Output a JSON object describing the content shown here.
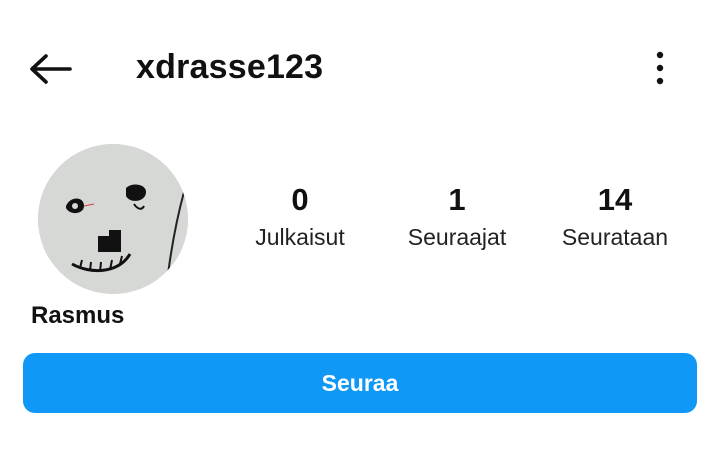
{
  "header": {
    "username": "xdrasse123",
    "back_icon": "arrow-left-icon",
    "more_icon": "more-vertical-icon"
  },
  "profile": {
    "display_name": "Rasmus",
    "avatar_description_icon": "avatar"
  },
  "stats": [
    {
      "value": "0",
      "label": "Julkaisut"
    },
    {
      "value": "1",
      "label": "Seuraajat"
    },
    {
      "value": "14",
      "label": "Seurataan"
    }
  ],
  "actions": {
    "follow_label": "Seuraa"
  },
  "colors": {
    "accent": "#0f98f6",
    "text": "#111111",
    "background": "#ffffff"
  }
}
